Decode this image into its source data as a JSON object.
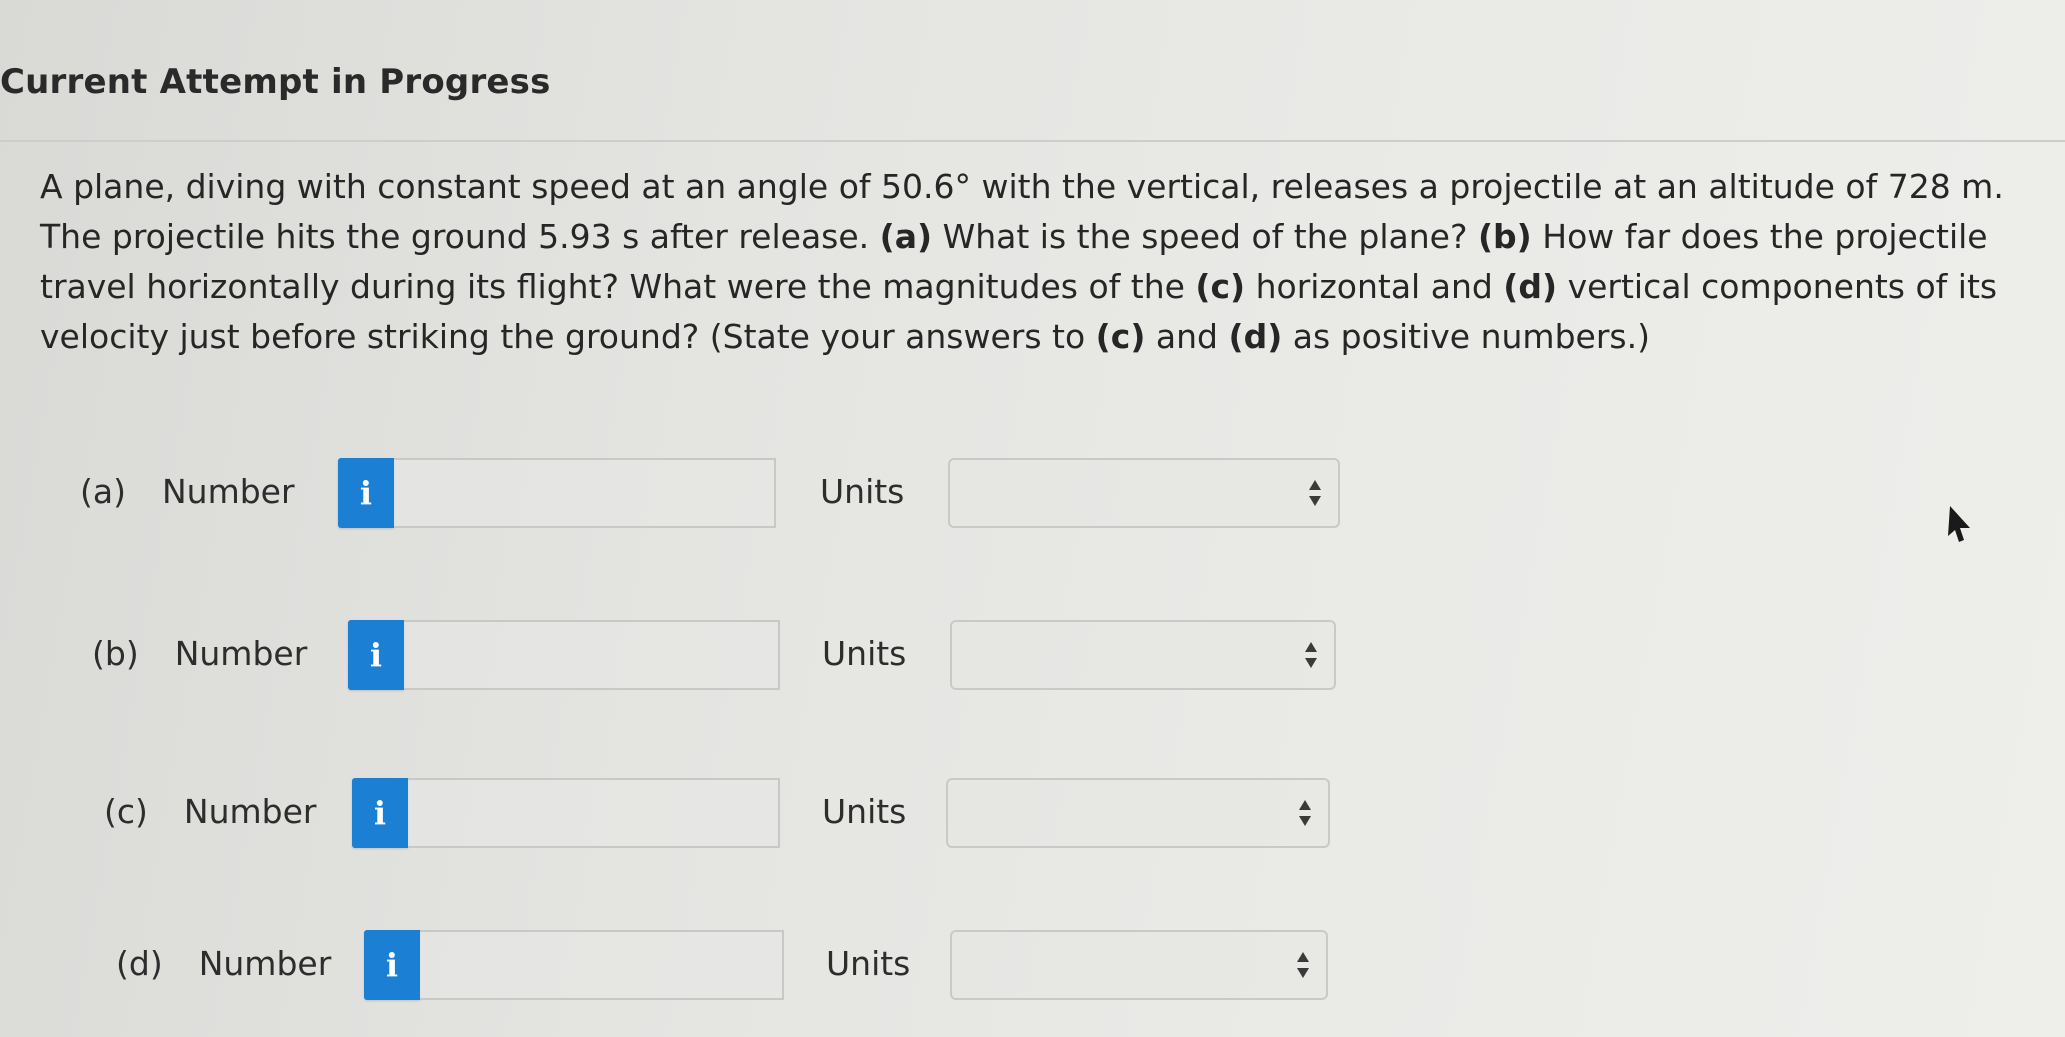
{
  "header": {
    "title": "Current Attempt in Progress"
  },
  "question": {
    "segments": [
      {
        "text": "A plane, diving with constant speed at an angle of 50.6° with the vertical, releases a projectile at an altitude of 728 m. The projectile hits the ground 5.93 s after release. ",
        "bold": false
      },
      {
        "text": "(a)",
        "bold": true
      },
      {
        "text": " What is the speed of the plane? ",
        "bold": false
      },
      {
        "text": "(b)",
        "bold": true
      },
      {
        "text": " How far does the projectile travel horizontally during its flight? What were the magnitudes of the ",
        "bold": false
      },
      {
        "text": "(c)",
        "bold": true
      },
      {
        "text": " horizontal and ",
        "bold": false
      },
      {
        "text": "(d)",
        "bold": true
      },
      {
        "text": " vertical components of its velocity just before striking the ground? (State your answers to ",
        "bold": false
      },
      {
        "text": "(c)",
        "bold": true
      },
      {
        "text": " and ",
        "bold": false
      },
      {
        "text": "(d)",
        "bold": true
      },
      {
        "text": " as positive numbers.)",
        "bold": false
      }
    ]
  },
  "answers": {
    "info_glyph": "i",
    "number_label": "Number",
    "units_label": "Units",
    "parts": [
      {
        "letter": "(a)",
        "value": "",
        "units": ""
      },
      {
        "letter": "(b)",
        "value": "",
        "units": ""
      },
      {
        "letter": "(c)",
        "value": "",
        "units": ""
      },
      {
        "letter": "(d)",
        "value": "",
        "units": ""
      }
    ]
  },
  "colors": {
    "info_button": "#1b7fd4",
    "text": "#2b2b2b"
  },
  "icons": {
    "info": "info-icon",
    "select_arrows": "up-down-arrows-icon",
    "cursor": "mouse-pointer-icon"
  }
}
